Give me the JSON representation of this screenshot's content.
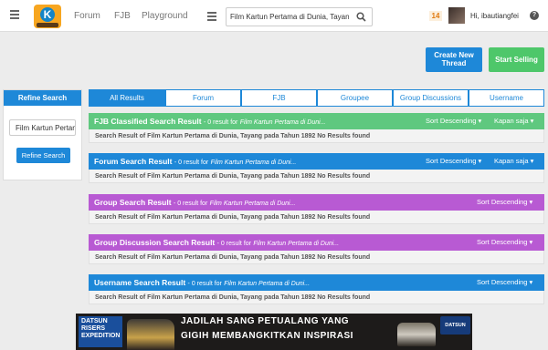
{
  "header": {
    "nav": [
      "Forum",
      "FJB",
      "Playground"
    ],
    "search_value": "Film Kartun Pertama di Dunia, Tayang",
    "notifications": "14",
    "user": "Hi, ibautiangfei",
    "help": "?"
  },
  "actions": {
    "create_thread": [
      "Create New",
      "Thread"
    ],
    "start_selling": "Start Selling"
  },
  "sidebar": {
    "title": "Refine Search",
    "input_value": "Film Kartun Pertan",
    "button": "Refine Search"
  },
  "tabs": [
    "All Results",
    "Forum",
    "FJB",
    "Groupee",
    "Group Discussions",
    "Username"
  ],
  "sections": [
    {
      "title": "FJB Classified Search Result",
      "count": "- 0 result for",
      "query": "Film Kartun Pertama di Duni...",
      "sort": "Sort Descending",
      "time": "Kapan saja",
      "body": "Search Result of Film Kartun Pertama di Dunia, Tayang pada Tahun 1892 No Results found",
      "color": "#5fc87f"
    },
    {
      "title": "Forum Search Result",
      "count": "- 0 result for",
      "query": "Film Kartun Pertama di Duni...",
      "sort": "Sort Descending",
      "time": "Kapan saja",
      "body": "Search Result of Film Kartun Pertama di Dunia, Tayang pada Tahun 1892 No Results found",
      "color": "#1e88d8"
    },
    {
      "title": "Group Search Result",
      "count": "- 0 result for",
      "query": "Film Kartun Pertama di Duni...",
      "sort": "Sort Descending",
      "time": "",
      "body": "Search Result of Film Kartun Pertama di Dunia, Tayang pada Tahun 1892 No Results found",
      "color": "#b85ad3"
    },
    {
      "title": "Group Discussion Search Result",
      "count": "- 0 result for",
      "query": "Film Kartun Pertama di Duni...",
      "sort": "Sort Descending",
      "time": "",
      "body": "Search Result of Film Kartun Pertama di Dunia, Tayang pada Tahun 1892 No Results found",
      "color": "#b85ad3"
    },
    {
      "title": "Username Search Result",
      "count": "- 0 result for",
      "query": "Film Kartun Pertama di Duni...",
      "sort": "Sort Descending",
      "time": "",
      "body": "Search Result of Film Kartun Pertama di Dunia, Tayang pada Tahun 1892 No Results found",
      "color": "#1e88d8"
    }
  ],
  "banner": {
    "brand_lines": [
      "DATSUN",
      "RISERS",
      "EXPEDITION"
    ],
    "headline1": "JADILAH SANG PETUALANG YANG",
    "headline2": "GIGIH MEMBANGKITKAN INSPIRASI",
    "logo": "DATSUN"
  },
  "colors": {
    "accent": "#1e88d8",
    "green": "#5fc87f",
    "purple": "#b85ad3"
  }
}
